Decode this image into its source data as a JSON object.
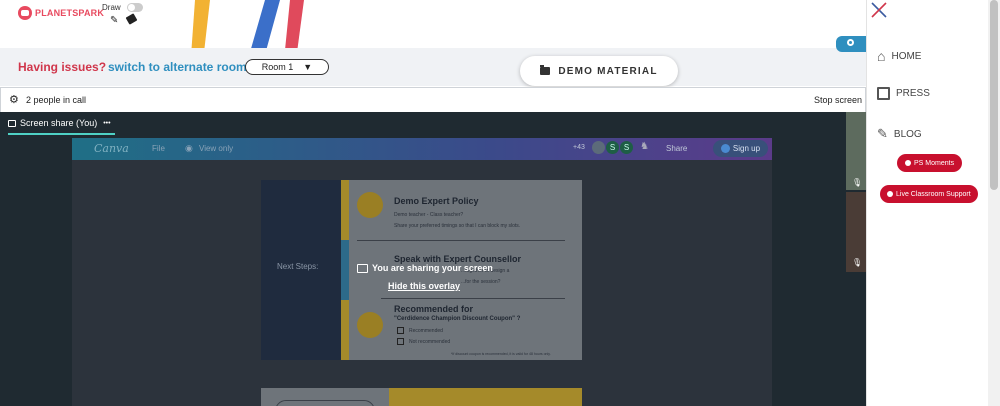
{
  "brand": {
    "name": "PLANETSPARK"
  },
  "draw": {
    "label": "Draw"
  },
  "issues": {
    "text": "Having issues?",
    "link": "switch to alternate room"
  },
  "room": {
    "selected": "Room 1"
  },
  "demo": {
    "label": "DEMO MATERIAL"
  },
  "call": {
    "people": "2 people in call",
    "stop": "Stop screen"
  },
  "share": {
    "tab": "Screen share (You)",
    "more": "•••"
  },
  "canva": {
    "logo": "Canva",
    "file": "File",
    "view": "View only",
    "count": "+43",
    "share": "Share",
    "signup": "Sign up"
  },
  "slide": {
    "left": "Next Steps:",
    "h1": "Demo Expert Policy",
    "p1a": "Demo teacher - Class teacher?",
    "p1b": "Share your preferred timings so that I can block my slots.",
    "h2": "Speak with Expert Counsellor",
    "p2a": "...together to design a",
    "p2b": "...for the session?",
    "h3": "Recommended for",
    "h3b": "\"Cerdidence Champion Discount Coupon\" ?",
    "opt1": "Recommended",
    "opt2": "Not recommended",
    "note": "*If discount coupon is recommended, it is valid for 48 hours only."
  },
  "overlay": {
    "text": "You are sharing your screen",
    "hide": "Hide this overlay"
  },
  "sidebar": {
    "home": "HOME",
    "press": "PRESS",
    "blog": "BLOG",
    "moments": "PS Moments",
    "support": "Live Classroom Support"
  },
  "colors": {
    "accent": "#c8102e",
    "link": "#2f8fbf",
    "issue": "#d0364b"
  }
}
